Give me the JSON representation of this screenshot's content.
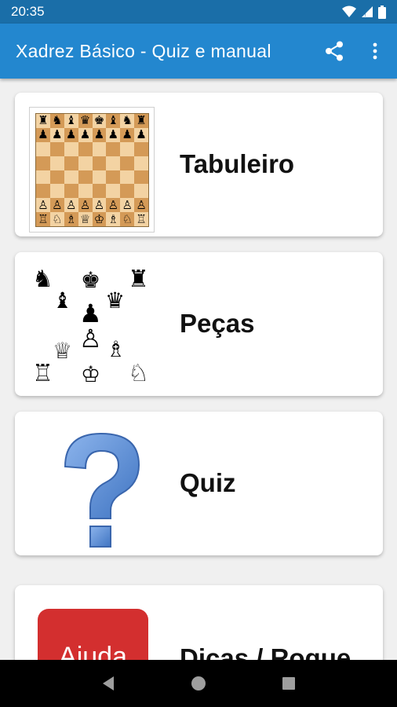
{
  "status_bar": {
    "time": "20:35"
  },
  "app_bar": {
    "title": "Xadrez Básico - Quiz e manual"
  },
  "cards": [
    {
      "label": "Tabuleiro"
    },
    {
      "label": "Peças"
    },
    {
      "label": "Quiz"
    },
    {
      "label": "Dicas / Roque",
      "image_text": "Ajuda"
    }
  ],
  "board": {
    "ranks": [
      "♜♞♝♛♚♝♞♜",
      "♟♟♟♟♟♟♟♟",
      "        ",
      "        ",
      "        ",
      "        ",
      "♙♙♙♙♙♙♙♙",
      "♖♘♗♕♔♗♘♖"
    ]
  },
  "colors": {
    "status_bar": "#1a6ea8",
    "app_bar": "#2387cf",
    "help_tile": "#d32f2f",
    "question_mark": "#5b8fd6"
  }
}
